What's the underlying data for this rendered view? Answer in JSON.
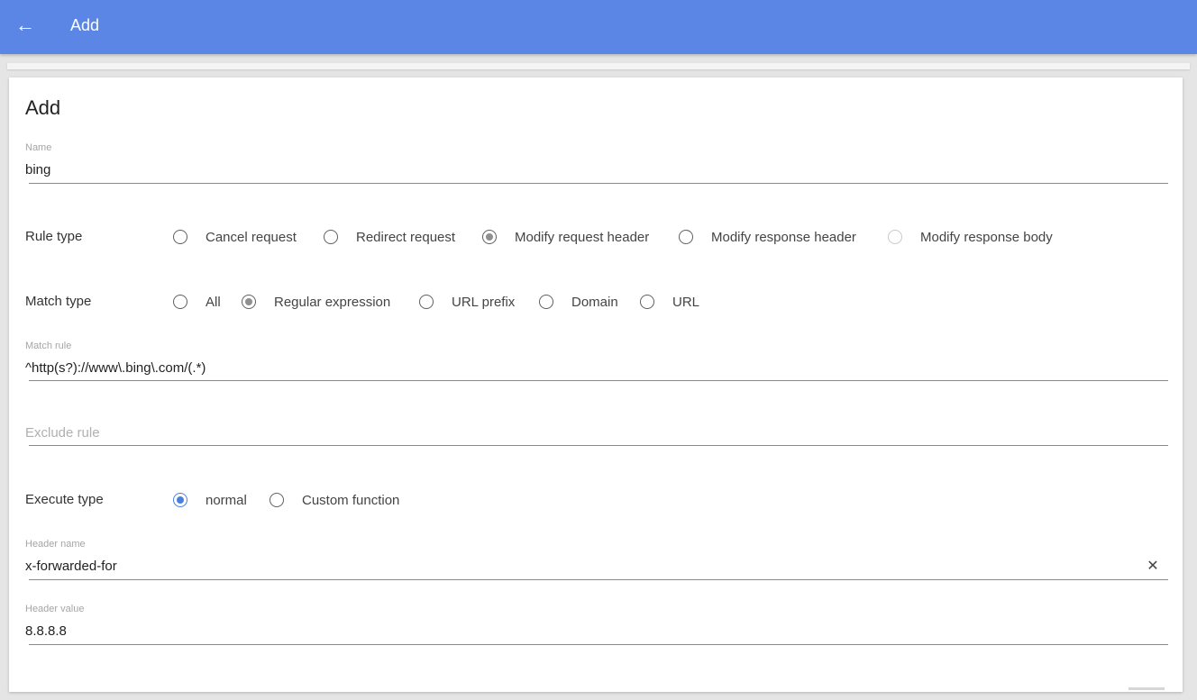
{
  "header": {
    "back_icon": "←",
    "title": "Add"
  },
  "card": {
    "title": "Add"
  },
  "name_field": {
    "label": "Name",
    "value": "bing"
  },
  "rule_type": {
    "label": "Rule type",
    "options": [
      {
        "label": "Cancel request",
        "selected": false
      },
      {
        "label": "Redirect request",
        "selected": false
      },
      {
        "label": "Modify request header",
        "selected": true
      },
      {
        "label": "Modify response header",
        "selected": false
      },
      {
        "label": "Modify response body",
        "selected": false
      }
    ]
  },
  "match_type": {
    "label": "Match type",
    "options": [
      {
        "label": "All",
        "selected": false
      },
      {
        "label": "Regular expression",
        "selected": true
      },
      {
        "label": "URL prefix",
        "selected": false
      },
      {
        "label": "Domain",
        "selected": false
      },
      {
        "label": "URL",
        "selected": false
      }
    ]
  },
  "match_rule_field": {
    "label": "Match rule",
    "value": "^http(s?)://www\\.bing\\.com/(.*)"
  },
  "exclude_rule_field": {
    "placeholder": "Exclude rule",
    "value": ""
  },
  "execute_type": {
    "label": "Execute type",
    "options": [
      {
        "label": "normal",
        "selected": true
      },
      {
        "label": "Custom function",
        "selected": false
      }
    ]
  },
  "header_name_field": {
    "label": "Header name",
    "value": "x-forwarded-for",
    "clear_icon": "✕"
  },
  "header_value_field": {
    "label": "Header value",
    "value": "8.8.8.8"
  },
  "colors": {
    "app_bar": "#5b86e5",
    "selected_radio": "#4a80d9"
  }
}
